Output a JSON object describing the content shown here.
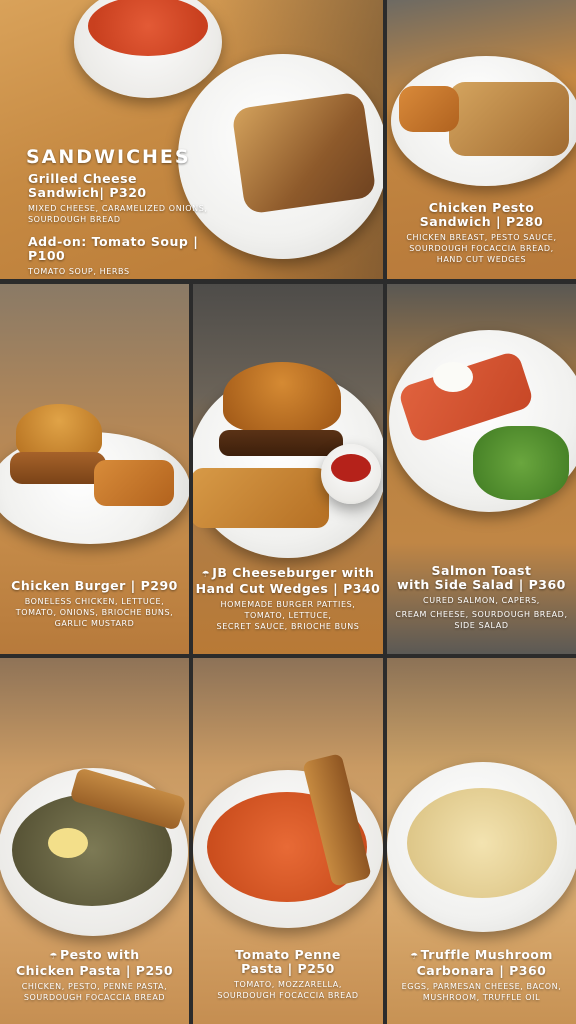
{
  "section_title": "SANDWICHES",
  "items": [
    {
      "title": "Grilled Cheese Sandwich| P320",
      "desc": "MIXED CHEESE, CARAMELIZED ONIONS, SOURDOUGH BREAD",
      "addon_title": "Add-on: Tomato Soup | P100",
      "addon_desc": "TOMATO SOUP, HERBS"
    },
    {
      "title_line1": "Chicken Pesto",
      "title_line2": "Sandwich | P280",
      "desc_line1": "CHICKEN BREAST, PESTO SAUCE,",
      "desc_line2": "SOURDOUGH FOCACCIA BREAD,",
      "desc_line3": "HAND CUT WEDGES"
    },
    {
      "title_line1": "Chicken Burger | P290",
      "desc_line1": "BONELESS CHICKEN, LETTUCE,",
      "desc_line2": "TOMATO, ONIONS, BRIOCHE BUNS,",
      "desc_line3": "GARLIC MUSTARD"
    },
    {
      "title_line1": "JB Cheeseburger with",
      "title_line2": "Hand Cut Wedges | P340",
      "desc_line1": "HOMEMADE BURGER PATTIES,",
      "desc_line2": "TOMATO, LETTUCE,",
      "desc_line3": "SECRET SAUCE, BRIOCHE BUNS",
      "icon": "recommended-icon"
    },
    {
      "title_line1": "Salmon Toast",
      "title_line2": "with Side Salad  | P360",
      "desc_line1": "CURED SALMON, CAPERS,",
      "desc_line2": "CREAM CHEESE, SOURDOUGH BREAD,",
      "desc_line3": "SIDE SALAD"
    },
    {
      "title_line1": "Pesto with",
      "title_line2": "Chicken Pasta | P250",
      "desc_line1": "CHICKEN, PESTO, PENNE PASTA,",
      "desc_line2": "SOURDOUGH FOCACCIA BREAD",
      "icon": "recommended-icon"
    },
    {
      "title_line1": "Tomato Penne",
      "title_line2": "Pasta | P250",
      "desc_line1": "TOMATO, MOZZARELLA,",
      "desc_line2": "SOURDOUGH FOCACCIA BREAD"
    },
    {
      "title_line1": "Truffle Mushroom",
      "title_line2": "Carbonara | P360",
      "desc_line1": "EGGS, PARMESAN CHEESE, BACON,",
      "desc_line2": "MUSHROOM, TRUFFLE OIL",
      "icon": "recommended-icon"
    }
  ]
}
